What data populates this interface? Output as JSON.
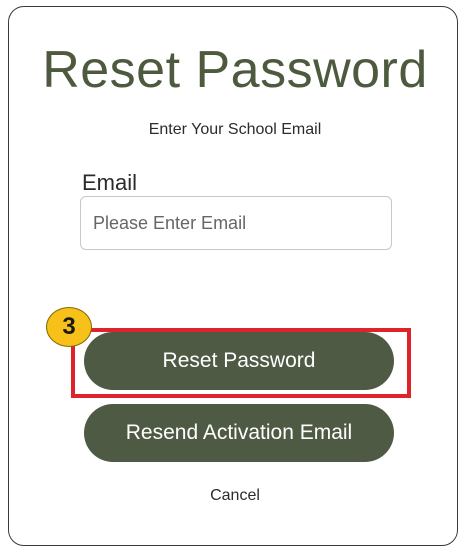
{
  "form": {
    "title": "Reset Password",
    "subtitle": "Enter Your School Email",
    "email_label": "Email",
    "email_placeholder": "Please Enter Email",
    "email_value": "",
    "reset_button_label": "Reset Password",
    "resend_button_label": "Resend Activation Email",
    "cancel_label": "Cancel"
  },
  "annotation": {
    "step_number": "3",
    "badge_color": "#f7c11a",
    "highlight_color": "#e0222b"
  },
  "colors": {
    "title": "#4d5a3e",
    "button": "#4f5a44"
  }
}
